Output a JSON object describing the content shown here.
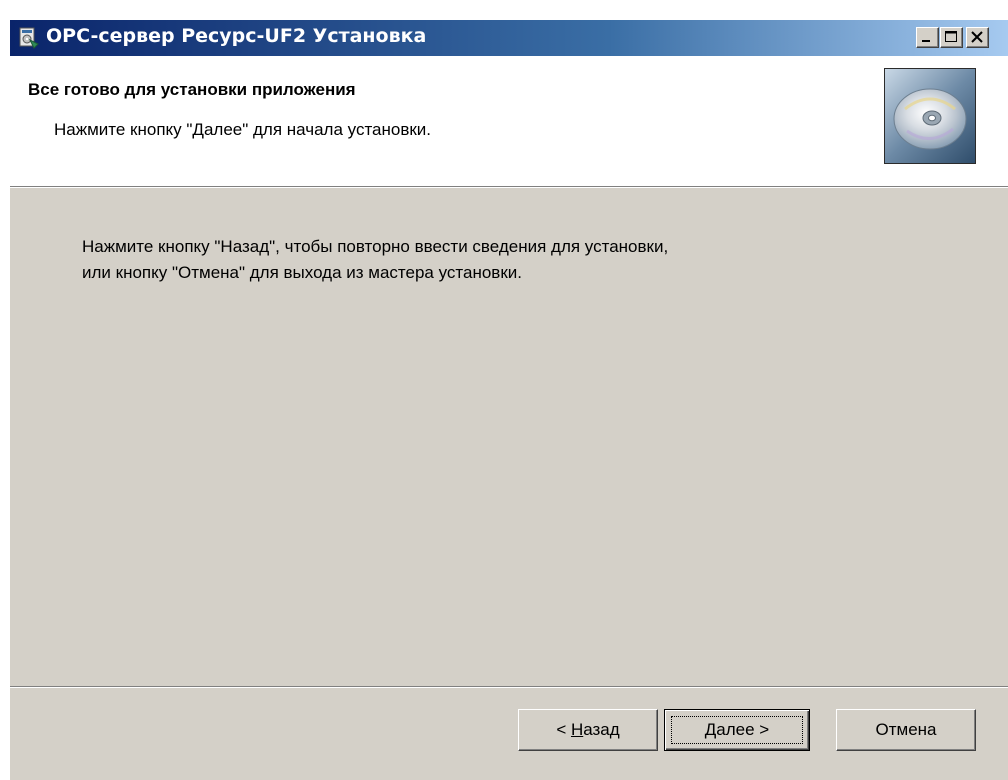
{
  "window": {
    "title": "OPC-сервер Ресурс-UF2 Установка",
    "minimize_icon": "minimize-icon",
    "maximize_icon": "maximize-icon",
    "close_icon": "close-icon"
  },
  "header": {
    "title": "Все готово для установки приложения",
    "subtitle": "Нажмите кнопку \"Далее\" для начала установки.",
    "image_icon": "cd-disc-icon"
  },
  "body": {
    "line1": "Нажмите кнопку \"Назад\", чтобы повторно ввести сведения для установки,",
    "line2": "или кнопку \"Отмена\" для выхода из мастера установки."
  },
  "buttons": {
    "back_prefix": "< ",
    "back_mnemonic": "Н",
    "back_rest": "азад",
    "next_mnemonic": "Д",
    "next_rest": "алее >",
    "cancel": "Отмена"
  }
}
